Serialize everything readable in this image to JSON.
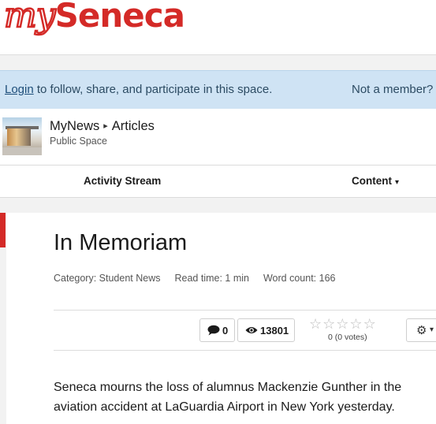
{
  "header": {
    "logo_my": "my",
    "logo_seneca": "Seneca"
  },
  "banner": {
    "login_label": "Login",
    "message": " to follow, share, and participate in this space.",
    "not_member": "Not a member?"
  },
  "place": {
    "title": "MyNews",
    "separator": "▸",
    "section": "Articles",
    "subtitle": "Public Space"
  },
  "nav": {
    "activity": "Activity Stream",
    "content": "Content",
    "content_caret": "▾"
  },
  "article": {
    "title": "In Memoriam",
    "category": "Category: Student News",
    "read_time": "Read time: 1 min",
    "word_count": "Word count: 166",
    "comments_count": "0",
    "views_count": "13801",
    "stars_filled": 0,
    "stars_total": 5,
    "votes_label": "0 (0 votes)",
    "body": "Seneca mourns the loss of alumnus Mackenzie Gunther in the aviation accident at LaGuardia Airport in New York yesterday."
  },
  "icons": {
    "comment": "comment-icon",
    "views": "eye-icon",
    "star": "star-icon",
    "gear": "gear-icon",
    "caret": "caret-down-icon"
  },
  "colors": {
    "brand_red": "#d42a27",
    "banner_bg": "#cfe3f4",
    "link": "#1e4e7a"
  }
}
